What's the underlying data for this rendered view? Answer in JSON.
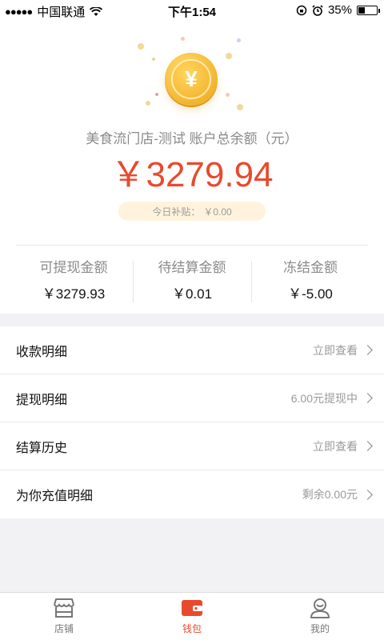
{
  "status_bar": {
    "carrier": "中国联通",
    "time": "下午1:54",
    "battery": "35%"
  },
  "wallet": {
    "account_label": "美食流门店-测试 账户总余额（元）",
    "total_amount": "￥3279.94",
    "subsidy_label": "今日补贴：",
    "subsidy_value": "￥0.00",
    "stats": [
      {
        "label": "可提现金额",
        "value": "￥3279.93"
      },
      {
        "label": "待结算金额",
        "value": "￥0.01"
      },
      {
        "label": "冻结金额",
        "value": "￥-5.00"
      }
    ]
  },
  "menu": [
    {
      "label": "收款明细",
      "value": "立即查看"
    },
    {
      "label": "提现明细",
      "value": "6.00元提现中"
    },
    {
      "label": "结算历史",
      "value": "立即查看"
    },
    {
      "label": "为你充值明细",
      "value": "剩余0.00元"
    }
  ],
  "tabs": [
    {
      "label": "店铺",
      "icon": "store-icon"
    },
    {
      "label": "钱包",
      "icon": "wallet-icon",
      "active": true
    },
    {
      "label": "我的",
      "icon": "profile-icon"
    }
  ],
  "colors": {
    "accent": "#e84a2e",
    "coin": "#f3b731",
    "subsidy_bg": "#fff3dd"
  }
}
